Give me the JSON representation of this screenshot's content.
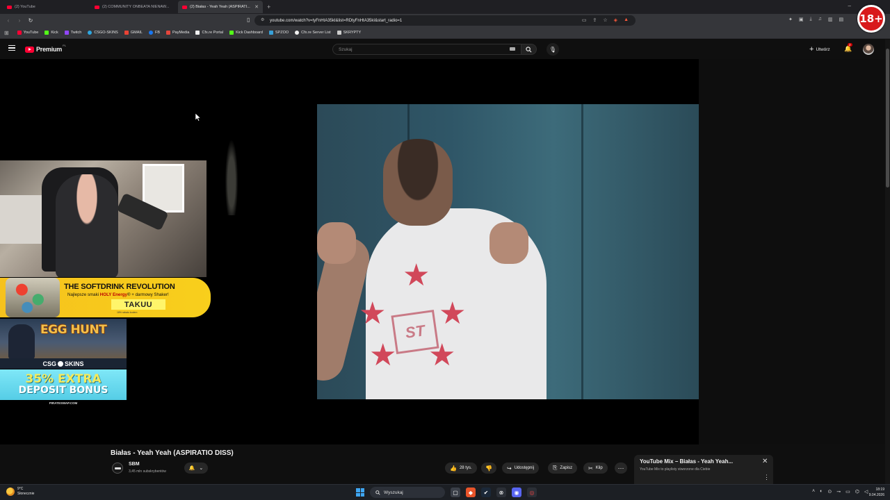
{
  "browser": {
    "tabs": [
      {
        "title": "(2) YouTube",
        "active": false
      },
      {
        "title": "(2) COMMUNITY ONBEATA NIENAW...",
        "active": false
      },
      {
        "title": "(2) Białas - Yeah Yeah (ASPIRATI...",
        "active": true
      }
    ],
    "new_tab": "+",
    "url": "youtube.com/watch?v=tyFnHtA35kI&list=RDtyFnHtA35kI&start_radio=1",
    "bookmarks": [
      {
        "label": "YouTube",
        "color": "#ff0033"
      },
      {
        "label": "Kick",
        "color": "#53fc18"
      },
      {
        "label": "Twitch",
        "color": "#9146ff"
      },
      {
        "label": "CSGO-SKINS",
        "color": "#2ea7e0"
      },
      {
        "label": "GMAIL",
        "color": "#ea4335"
      },
      {
        "label": "FB",
        "color": "#1877f2"
      },
      {
        "label": "PayMedia",
        "color": "#e5463c"
      },
      {
        "label": "Cfx.re Portal",
        "color": "#f0f0f0"
      },
      {
        "label": "Kick Dashboard",
        "color": "#53fc18"
      },
      {
        "label": "SPZOO",
        "color": "#38a0d8"
      },
      {
        "label": "Cfx.re Server List",
        "color": "#f0f0f0"
      },
      {
        "label": "SKRYPTY",
        "color": "#cccccc"
      }
    ]
  },
  "age_badge": "18+",
  "youtube": {
    "logo_text": "Premium",
    "logo_country": "PL",
    "search_placeholder": "Szukaj",
    "create_label": "Utwórz",
    "notifications_count": "2"
  },
  "overlay": {
    "promo_headline": "THE SOFTDRINK REVOLUTION",
    "promo_sub_prefix": "Najlepsze smaki ",
    "promo_sub_bold": "HOLY Energy",
    "promo_sub_suffix": "® + darmowy Shaker!",
    "promo_brand": "TAKUU",
    "promo_fine": "18% rabatu kodem",
    "egg_title": "EGG HUNT",
    "csgo_left": "CSG",
    "csgo_right": "SKINS",
    "bonus_line1": "35% EXTRA",
    "bonus_line2": "DEPOSIT BONUS",
    "pirate": "PIRATESWAP.COM"
  },
  "video": {
    "title": "Białas - Yeah Yeah (ASPIRATIO DISS)",
    "channel": "SBM",
    "subscribers": "3,45 mln subskrybentów",
    "likes": "28 tys.",
    "share_label": "Udostępnij",
    "save_label": "Zapisz",
    "clip_label": "Klip",
    "shirt_text": "ST"
  },
  "mix": {
    "title": "YouTube Mix – Białas - Yeah Yeah...",
    "subtitle": "YouTube Mix to playlisty stworzone dla Ciebie"
  },
  "taskbar": {
    "weather_temp": "9°C",
    "weather_desc": "Słonecznie",
    "search_label": "Wyszukaj",
    "time": "18:19",
    "date": "9.04.2026"
  }
}
